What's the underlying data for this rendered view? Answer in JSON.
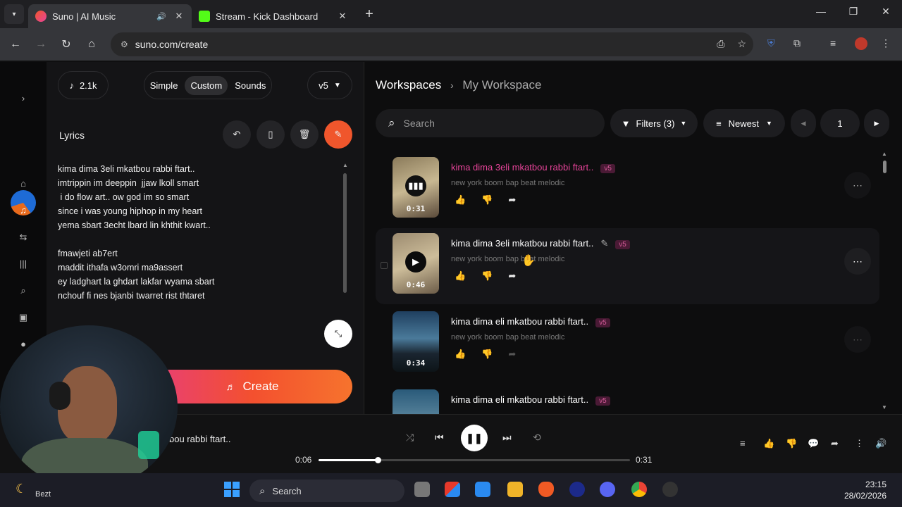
{
  "browser": {
    "tabs": [
      {
        "title": "Suno | AI Music",
        "active": true
      },
      {
        "title": "Stream - Kick Dashboard",
        "active": false
      }
    ],
    "url": "suno.com/create"
  },
  "left_panel": {
    "credits": "2.1k",
    "modes": [
      "Simple",
      "Custom",
      "Sounds"
    ],
    "active_mode": "Custom",
    "model": "v5",
    "lyrics_label": "Lyrics",
    "lyrics_text": "kima dima 3eli mkatbou rabbi ftart..\nimtrippin im deeppin  jjaw lkoll smart\n i do flow art.. ow god im so smart\nsince i was young hiphop in my heart\nyema sbart 3echt lbard lin khthit kwart..\n\nfmawjeti ab7ert\nmaddit ithafa w3omri ma9assert\ney ladghart la ghdart lakfar wyama sbart\nnchouf fi nes bjanbi twarret rist thtaret",
    "create_label": "Create"
  },
  "workspace": {
    "breadcrumb_root": "Workspaces",
    "breadcrumb_current": "My Workspace",
    "search_placeholder": "Search",
    "filters_label": "Filters (3)",
    "sort_label": "Newest",
    "page": "1",
    "songs": [
      {
        "title": "kima dima 3eli mkatbou rabbi ftart..",
        "version": "v5",
        "style": "new york boom bap beat melodic",
        "duration": "0:31",
        "playing": true
      },
      {
        "title": "kima dima 3eli mkatbou rabbi ftart..",
        "version": "v5",
        "style": "new york boom bap beat melodic",
        "duration": "0:46",
        "playing": false
      },
      {
        "title": "kima dima eli mkatbou rabbi ftart..",
        "version": "v5",
        "style": "new york boom bap beat melodic",
        "duration": "0:34",
        "playing": false
      },
      {
        "title": "kima dima eli mkatbou rabbi ftart..",
        "version": "v5",
        "style": "",
        "duration": "",
        "playing": false
      }
    ]
  },
  "player": {
    "now_playing_title": "bou rabbi ftart..",
    "elapsed": "0:06",
    "total": "0:31",
    "progress_fraction": 0.19
  },
  "taskbar": {
    "search_label": "Search",
    "time": "23:15",
    "date": "28/02/2026",
    "weather_text": "Bezt"
  }
}
